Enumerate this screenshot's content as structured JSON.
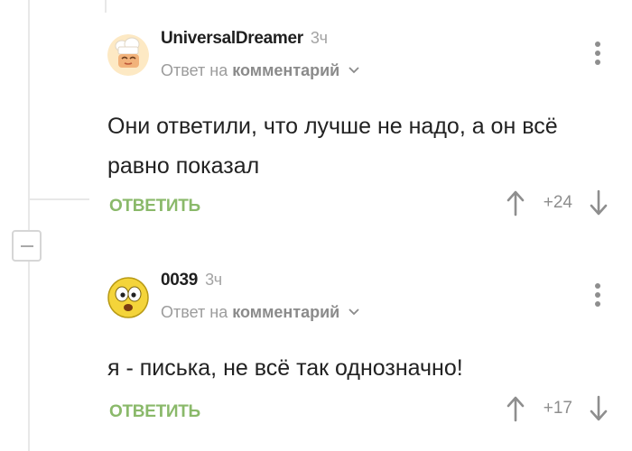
{
  "colors": {
    "accent_green": "#8ab96a",
    "muted_gray": "#9c9c9c",
    "text_dark": "#222222"
  },
  "thread": {
    "collapse_icon": "minus-icon"
  },
  "comments": [
    {
      "author": "UniversalDreamer",
      "time": "3ч",
      "avatar_icon": "chef-avatar",
      "reply_prefix": "Ответ на",
      "reply_link": "комментарий",
      "text": "Они ответили, что лучше не надо, а он всё равно показал",
      "reply_label": "ОТВЕТИТЬ",
      "score": "+24",
      "menu_icon": "more-vertical-icon"
    },
    {
      "author": "0039",
      "time": "3ч",
      "avatar_icon": "shocked-emoji-avatar",
      "reply_prefix": "Ответ на",
      "reply_link": "комментарий",
      "text": "я - писька, не всё так однозначно!",
      "reply_label": "ОТВЕТИТЬ",
      "score": "+17",
      "menu_icon": "more-vertical-icon"
    }
  ]
}
